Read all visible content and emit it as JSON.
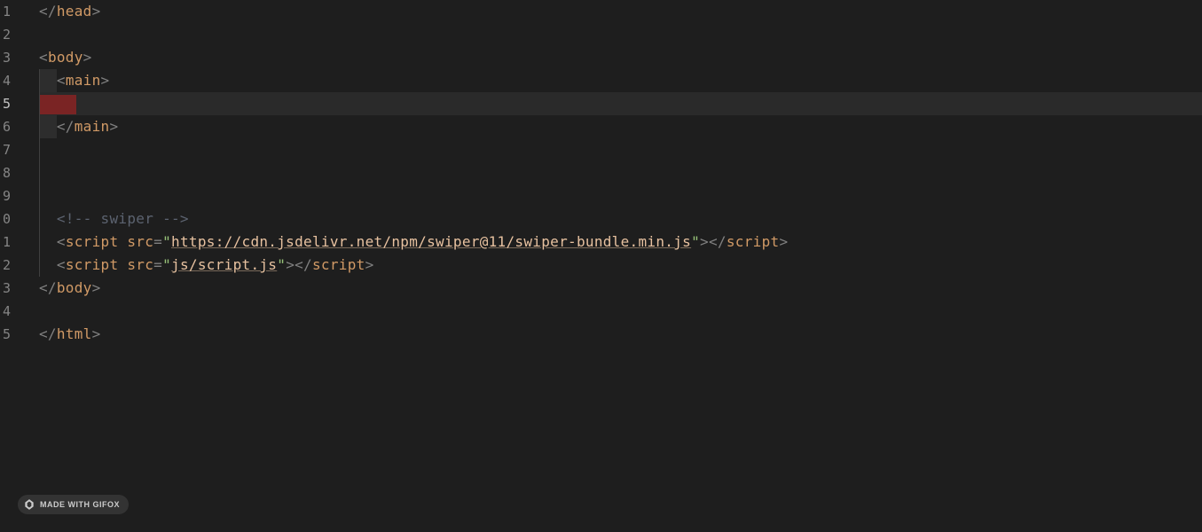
{
  "gutter": {
    "lines": [
      "1",
      "2",
      "3",
      "4",
      "5",
      "6",
      "7",
      "8",
      "9",
      "0",
      "1",
      "2",
      "3",
      "4",
      "5"
    ],
    "active_index": 4
  },
  "code": {
    "line1_closetag": "head",
    "line3_tag": "body",
    "line4_tag": "main",
    "line6_tag": "main",
    "line10_comment": "<!-- swiper -->",
    "line11_tag": "script",
    "line11_attr": "src",
    "line11_url": "https://cdn.jsdelivr.net/npm/swiper@11/swiper-bundle.min.js",
    "line12_tag": "script",
    "line12_attr": "src",
    "line12_url": "js/script.js",
    "line13_tag": "body",
    "line15_tag": "html"
  },
  "watermark": {
    "text": "MADE WITH GIFOX"
  }
}
